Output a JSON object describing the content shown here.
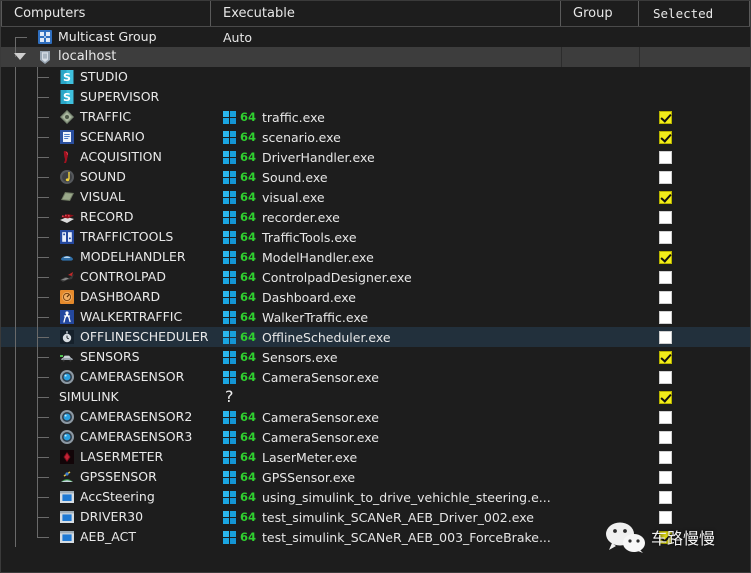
{
  "columns": [
    {
      "id": "computers",
      "label": "Computers"
    },
    {
      "id": "executable",
      "label": "Executable"
    },
    {
      "id": "group",
      "label": "Group"
    },
    {
      "id": "selected",
      "label": "Selected"
    }
  ],
  "colors": {
    "background": "#1d1d1d",
    "header_text": "#e8e8e8",
    "row_text": "#e9e9e9",
    "selected_row": "#22303c",
    "host_row": "#3d3d3d",
    "checkbox_on": "#f2ed1a",
    "checkbox_off": "#ffffff",
    "bits_green": "#2fd12f",
    "windows_blue": "#1ba9e0",
    "tree_line": "#6a6a6a"
  },
  "rows": [
    {
      "name": "Multicast Group",
      "executable": "Auto",
      "group": "",
      "icon": "multicast-group-icon",
      "depth": 0,
      "bits": "",
      "checkbox": null,
      "selected": false,
      "kind": "multicast"
    },
    {
      "name": "localhost",
      "executable": "",
      "group": "",
      "icon": "host-shield-icon",
      "depth": 0,
      "bits": "",
      "checkbox": null,
      "selected": false,
      "kind": "host",
      "expanded": true
    },
    {
      "name": "STUDIO",
      "executable": "",
      "group": "",
      "icon": "studio-icon",
      "depth": 1,
      "bits": "",
      "checkbox": null,
      "selected": false,
      "kind": "module"
    },
    {
      "name": "SUPERVISOR",
      "executable": "",
      "group": "",
      "icon": "studio-icon",
      "depth": 1,
      "bits": "",
      "checkbox": null,
      "selected": false,
      "kind": "module"
    },
    {
      "name": "TRAFFIC",
      "executable": "traffic.exe",
      "group": "",
      "icon": "traffic-icon",
      "depth": 1,
      "bits": "64",
      "checkbox": true,
      "selected": false,
      "kind": "module"
    },
    {
      "name": "SCENARIO",
      "executable": "scenario.exe",
      "group": "",
      "icon": "scenario-document-icon",
      "depth": 1,
      "bits": "64",
      "checkbox": true,
      "selected": false,
      "kind": "module"
    },
    {
      "name": "ACQUISITION",
      "executable": "DriverHandler.exe",
      "group": "",
      "icon": "acquisition-seat-icon",
      "depth": 1,
      "bits": "64",
      "checkbox": false,
      "selected": false,
      "kind": "module"
    },
    {
      "name": "SOUND",
      "executable": "Sound.exe",
      "group": "",
      "icon": "sound-note-icon",
      "depth": 1,
      "bits": "64",
      "checkbox": false,
      "selected": false,
      "kind": "module"
    },
    {
      "name": "VISUAL",
      "executable": "visual.exe",
      "group": "",
      "icon": "visual-screen-icon",
      "depth": 1,
      "bits": "64",
      "checkbox": true,
      "selected": false,
      "kind": "module"
    },
    {
      "name": "RECORD",
      "executable": "recorder.exe",
      "group": "",
      "icon": "record-icon",
      "depth": 1,
      "bits": "64",
      "checkbox": false,
      "selected": false,
      "kind": "module"
    },
    {
      "name": "TRAFFICTOOLS",
      "executable": "TrafficTools.exe",
      "group": "",
      "icon": "traffictools-icon",
      "depth": 1,
      "bits": "64",
      "checkbox": false,
      "selected": false,
      "kind": "module"
    },
    {
      "name": "MODELHANDLER",
      "executable": "ModelHandler.exe",
      "group": "",
      "icon": "modelhandler-car-icon",
      "depth": 1,
      "bits": "64",
      "checkbox": true,
      "selected": false,
      "kind": "module"
    },
    {
      "name": "CONTROLPAD",
      "executable": "ControlpadDesigner.exe",
      "group": "",
      "icon": "controlpad-icon",
      "depth": 1,
      "bits": "64",
      "checkbox": false,
      "selected": false,
      "kind": "module"
    },
    {
      "name": "DASHBOARD",
      "executable": "Dashboard.exe",
      "group": "",
      "icon": "dashboard-gauge-icon",
      "depth": 1,
      "bits": "64",
      "checkbox": false,
      "selected": false,
      "kind": "module"
    },
    {
      "name": "WALKERTRAFFIC",
      "executable": "WalkerTraffic.exe",
      "group": "",
      "icon": "walker-pedestrian-icon",
      "depth": 1,
      "bits": "64",
      "checkbox": false,
      "selected": false,
      "kind": "module"
    },
    {
      "name": "OFFLINESCHEDULER",
      "executable": "OfflineScheduler.exe",
      "group": "",
      "icon": "offlinescheduler-clock-icon",
      "depth": 1,
      "bits": "64",
      "checkbox": false,
      "selected": true,
      "kind": "module"
    },
    {
      "name": "SENSORS",
      "executable": "Sensors.exe",
      "group": "",
      "icon": "sensors-car-icon",
      "depth": 1,
      "bits": "64",
      "checkbox": true,
      "selected": false,
      "kind": "module"
    },
    {
      "name": "CAMERASENSOR",
      "executable": "CameraSensor.exe",
      "group": "",
      "icon": "camera-sensor-icon",
      "depth": 1,
      "bits": "64",
      "checkbox": false,
      "selected": false,
      "kind": "module"
    },
    {
      "name": "SIMULINK",
      "executable": "?",
      "group": "",
      "icon": "",
      "depth": 1,
      "bits": "",
      "checkbox": true,
      "selected": false,
      "kind": "simulink"
    },
    {
      "name": "CAMERASENSOR2",
      "executable": "CameraSensor.exe",
      "group": "",
      "icon": "camera-sensor-icon",
      "depth": 1,
      "bits": "64",
      "checkbox": false,
      "selected": false,
      "kind": "module"
    },
    {
      "name": "CAMERASENSOR3",
      "executable": "CameraSensor.exe",
      "group": "",
      "icon": "camera-sensor-icon",
      "depth": 1,
      "bits": "64",
      "checkbox": false,
      "selected": false,
      "kind": "module"
    },
    {
      "name": "LASERMETER",
      "executable": "LaserMeter.exe",
      "group": "",
      "icon": "lasermeter-icon",
      "depth": 1,
      "bits": "64",
      "checkbox": false,
      "selected": false,
      "kind": "module"
    },
    {
      "name": "GPSSENSOR",
      "executable": "GPSSensor.exe",
      "group": "",
      "icon": "gps-satellite-icon",
      "depth": 1,
      "bits": "64",
      "checkbox": false,
      "selected": false,
      "kind": "module"
    },
    {
      "name": "AccSteering",
      "executable": "using_simulink_to_drive_vehichle_steering.e...",
      "group": "",
      "icon": "simulink-window-icon",
      "depth": 1,
      "bits": "64",
      "checkbox": false,
      "selected": false,
      "kind": "module"
    },
    {
      "name": "DRIVER30",
      "executable": "test_simulink_SCANeR_AEB_Driver_002.exe",
      "group": "",
      "icon": "simulink-window-icon",
      "depth": 1,
      "bits": "64",
      "checkbox": false,
      "selected": false,
      "kind": "module"
    },
    {
      "name": "AEB_ACT",
      "executable": "test_simulink_SCANeR_AEB_003_ForceBrake...",
      "group": "",
      "icon": "simulink-window-icon",
      "depth": 1,
      "bits": "64",
      "checkbox": true,
      "selected": false,
      "kind": "module"
    }
  ],
  "watermark": {
    "text": "车路慢慢",
    "icon": "wechat-logo-icon"
  }
}
